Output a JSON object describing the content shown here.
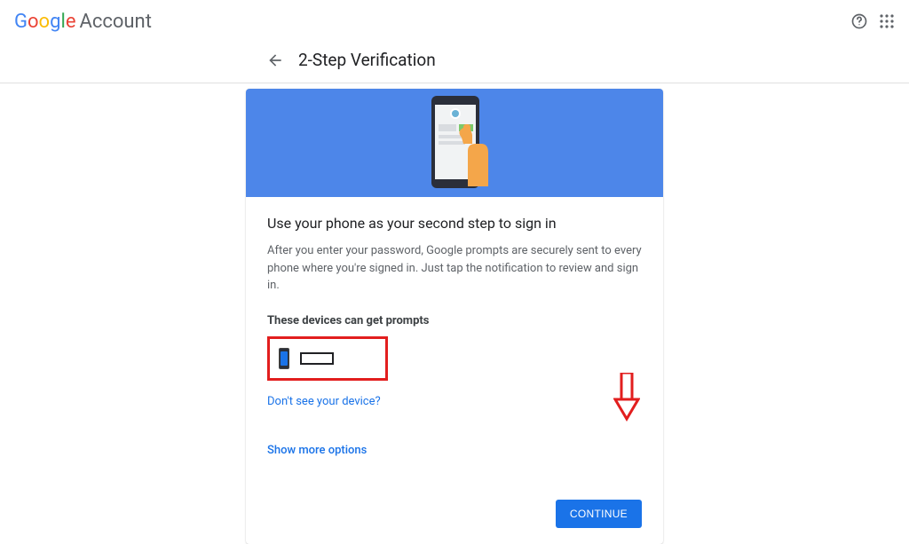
{
  "brand": {
    "word": "Google",
    "suffix": "Account"
  },
  "subheader": {
    "title": "2-Step Verification"
  },
  "card": {
    "title": "Use your phone as your second step to sign in",
    "desc": "After you enter your password, Google prompts are securely sent to every phone where you're signed in. Just tap the notification to review and sign in.",
    "devices_heading": "These devices can get prompts",
    "not_see_link": "Don't see your device?",
    "show_more_link": "Show more options",
    "continue_label": "CONTINUE"
  }
}
